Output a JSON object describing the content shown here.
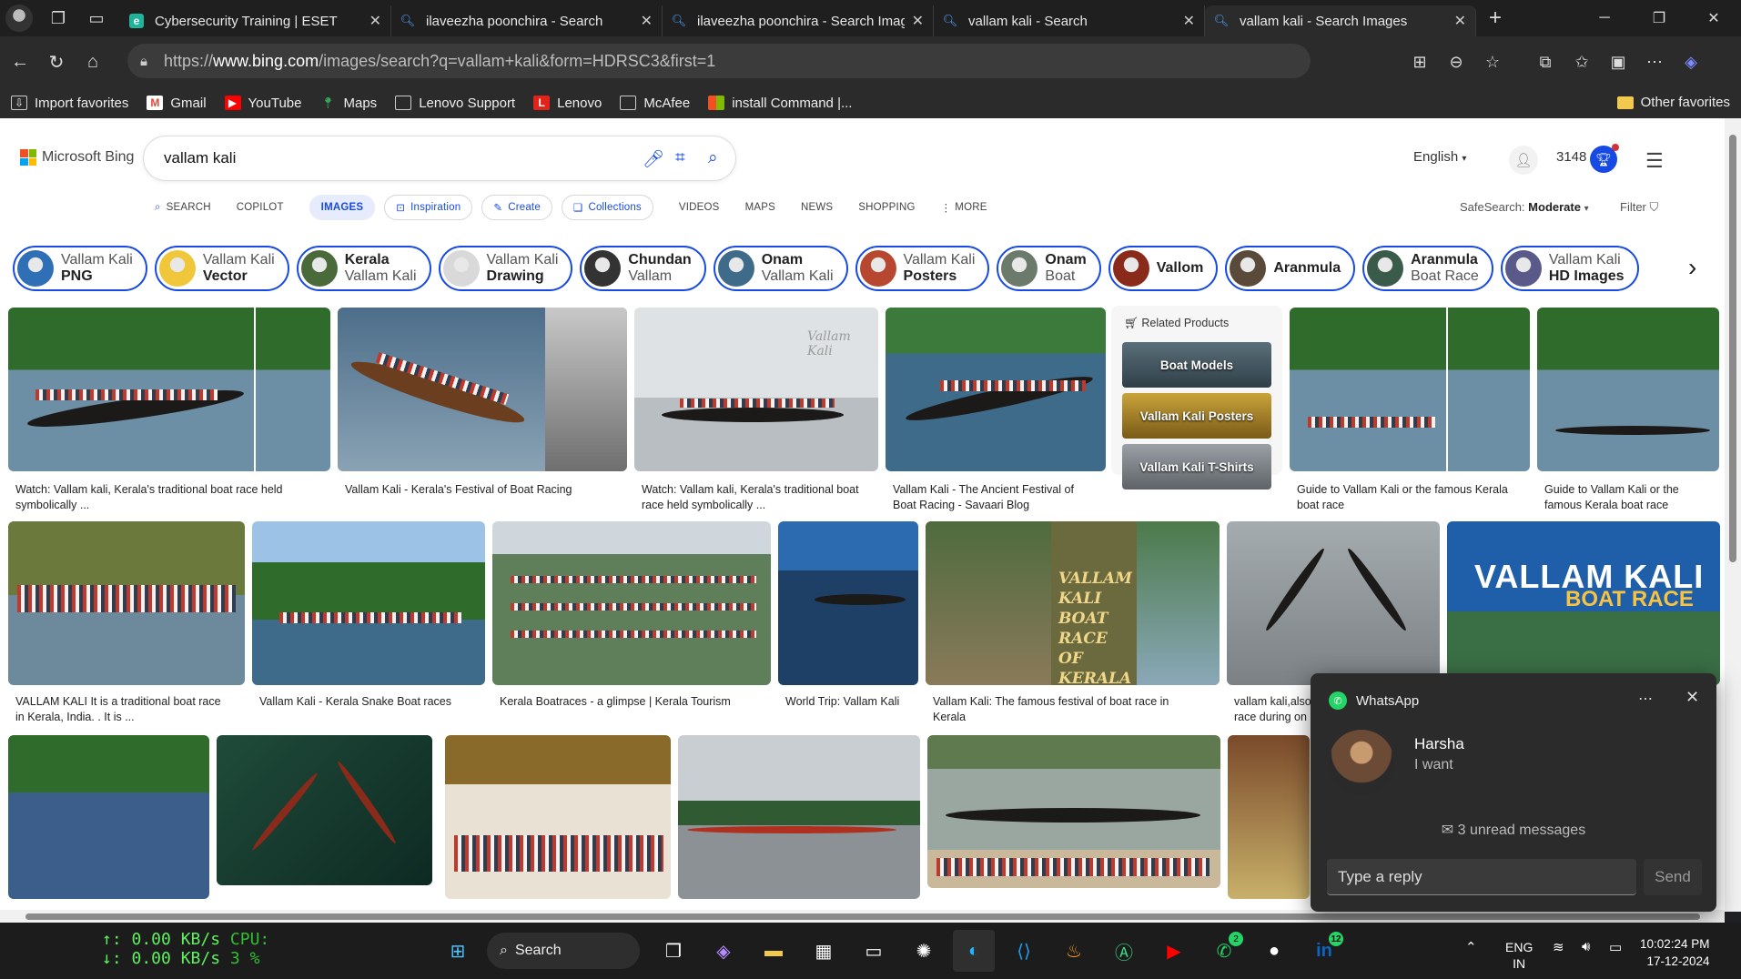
{
  "tabs": [
    {
      "title": "Cybersecurity Training | ESET",
      "favicon": "eset-icon"
    },
    {
      "title": "ilaveezha poonchira - Search",
      "favicon": "bing-search-icon"
    },
    {
      "title": "ilaveezha poonchira - Search Imag",
      "favicon": "bing-search-icon"
    },
    {
      "title": "vallam kali - Search",
      "favicon": "bing-search-icon"
    },
    {
      "title": "vallam kali - Search Images",
      "favicon": "bing-search-icon",
      "active": true
    }
  ],
  "address": {
    "prefix": "https://",
    "domain": "www.bing.com",
    "path": "/images/search?q=vallam+kali&form=HDRSC3&first=1"
  },
  "favorites": [
    {
      "label": "Import favorites",
      "icon": "import-icon"
    },
    {
      "label": "Gmail",
      "icon": "gmail-icon",
      "color": "#ea4335"
    },
    {
      "label": "YouTube",
      "icon": "youtube-icon",
      "color": "#ff0000"
    },
    {
      "label": "Maps",
      "icon": "maps-icon",
      "color": "#34a853"
    },
    {
      "label": "Lenovo Support",
      "icon": "page-icon"
    },
    {
      "label": "Lenovo",
      "icon": "lenovo-icon",
      "color": "#e2231a"
    },
    {
      "label": "McAfee",
      "icon": "page-icon"
    },
    {
      "label": "install Command |...",
      "icon": "windows-icon"
    }
  ],
  "other_favorites": "Other favorites",
  "bing": {
    "logo": "Microsoft Bing",
    "query": "vallam kali",
    "language": "English",
    "points": "3148",
    "scopes": [
      "SEARCH",
      "COPILOT",
      "IMAGES",
      "Inspiration",
      "Create",
      "Collections",
      "VIDEOS",
      "MAPS",
      "NEWS",
      "SHOPPING",
      "MORE"
    ],
    "safesearch_label": "SafeSearch:",
    "safesearch_value": "Moderate",
    "filter": "Filter"
  },
  "chips": [
    {
      "a": "Vallam Kali",
      "b": "PNG",
      "bold_first": false
    },
    {
      "a": "Vallam Kali",
      "b": "Vector",
      "bold_first": false
    },
    {
      "a": "Kerala",
      "b": "Vallam Kali",
      "bold_first": true
    },
    {
      "a": "Vallam Kali",
      "b": "Drawing",
      "bold_first": false
    },
    {
      "a": "Chundan",
      "b": "Vallam",
      "bold_first": true
    },
    {
      "a": "Onam",
      "b": "Vallam Kali",
      "bold_first": true
    },
    {
      "a": "Vallam Kali",
      "b": "Posters",
      "bold_first": false
    },
    {
      "a": "Onam",
      "b": "Boat",
      "bold_first": true
    },
    {
      "a": "Vallom",
      "b": "",
      "bold_first": true
    },
    {
      "a": "Aranmula",
      "b": "",
      "bold_first": true
    },
    {
      "a": "Aranmula",
      "b": "Boat Race",
      "bold_first": true
    },
    {
      "a": "Vallam Kali",
      "b": "HD Images",
      "bold_first": false
    }
  ],
  "results": {
    "r1": {
      "cap1": "Watch: Vallam kali, Kerala's traditional boat race held",
      "cap2": "symbolically ..."
    },
    "r2": {
      "cap1": "Vallam Kali - Kerala's Festival of Boat Racing",
      "cap2": ""
    },
    "r3": {
      "cap1": "Watch: Vallam kali, Kerala's traditional boat",
      "cap2": "race held symbolically ...",
      "watermark": "Vallam Kali"
    },
    "r4": {
      "cap1": "Vallam Kali - The Ancient Festival of",
      "cap2": "Boat Racing - Savaari Blog"
    },
    "r6": {
      "cap1": "Guide to Vallam Kali or the famous Kerala",
      "cap2": "boat race"
    },
    "r7": {
      "cap1": "Guide to Vallam Kali or the",
      "cap2": "famous Kerala boat race"
    },
    "r8": {
      "cap1": "VALLAM KALI It is a traditional boat race",
      "cap2": "in Kerala, India. . It is ..."
    },
    "r9": {
      "cap1": "Vallam Kali - Kerala Snake Boat races",
      "cap2": ""
    },
    "r10": {
      "cap1": "Kerala Boatraces - a glimpse | Kerala Tourism",
      "cap2": ""
    },
    "r11": {
      "cap1": "World Trip: Vallam Kali",
      "cap2": ""
    },
    "r12": {
      "cap1": "Vallam Kali: The famous festival of boat race in",
      "cap2": "Kerala",
      "overlay": "VALLAM KALI BOAT RACE OF KERALA"
    },
    "r13": {
      "cap1": "vallam kali,also",
      "cap2": "race during on"
    },
    "r14": {
      "title": "VALLAM KALI",
      "subtitle": "BOAT RACE"
    }
  },
  "related": {
    "title": "Related Products",
    "items": [
      "Boat Models",
      "Vallam Kali Posters",
      "Vallam Kali T-Shirts"
    ]
  },
  "whatsapp": {
    "app": "WhatsApp",
    "sender": "Harsha",
    "message": "I want",
    "unread": "3 unread messages",
    "placeholder": "Type a reply",
    "send": "Send"
  },
  "taskbar": {
    "net_up": "↑:  0.00 KB/s",
    "net_down": "↓:  0.00 KB/s",
    "cpu_label": "CPU:",
    "cpu_value": "3 %",
    "search": "Search",
    "whatsapp_badge": "2",
    "linkedin_badge": "12",
    "lang1": "ENG",
    "lang2": "IN",
    "time": "10:02:24 PM",
    "date": "17-12-2024"
  }
}
